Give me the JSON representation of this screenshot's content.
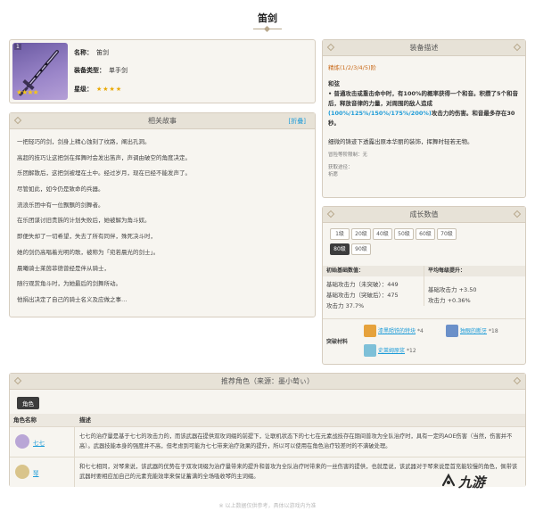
{
  "page": {
    "title": "笛剑"
  },
  "info": {
    "icon_num": "1",
    "stars_icon": "★★★★",
    "name_label": "名称：",
    "name_value": "笛剑",
    "type_label": "装备类型：",
    "type_value": "单手剑",
    "star_label": "星级：",
    "star_value": "★★★★"
  },
  "desc": {
    "title": "装备描述",
    "refine": "精炼(1/2/3/4/5)阶",
    "skill_name": "和弦",
    "skill_pre": "• 普通攻击或重击命中时，有100%的概率获得一个和音。积攒了5个和音后，释放音律的力量，对周围的敌人造成",
    "skill_hl": "(100%/125%/150%/175%/200%)",
    "skill_post": "攻击力的伤害。和音最多存在30秒。",
    "flavor": "细微的铸迹下透露出原本华丽的装饰，挥舞时轻若无物。",
    "limit": "冒险等阶限制：无",
    "source_label": "获取途径：",
    "source_value": "祈愿"
  },
  "story": {
    "title": "相关故事",
    "toggle": "[折叠]",
    "lines": [
      "一把轻巧的剑，剑身上精心蚀刻了纹路，阐出孔洞。",
      "高超的技巧让这把剑在挥舞时会发出笛声，声调由破空的角度决定。",
      "乐团解散后，这把剑被埋在土中。经过岁月，现在已经不能发声了。",
      "尽管如此，如今仍是致命的兵器。",
      "流浪乐团中有一位飘飘的剑舞者。",
      "在乐团谋讨旧贵族的计划失败后，她被解为角斗奴。",
      "即便失却了一切希望，失去了所有同伴，殊死决斗时，",
      "她的剑仍高唱着光明的歌，被称为「宛若晨光的剑士」。",
      "晨曦骑士莱茵菲德曾经是伴从骑士，",
      "随行观赏角斗时，为她最后的剑舞所动。",
      "他捐出决定了自己的骑士名义及应做之事…"
    ]
  },
  "growth": {
    "title": "成长数值",
    "levels": [
      "1级",
      "20级",
      "40级",
      "50级",
      "60级",
      "70级",
      "80级",
      "90级"
    ],
    "active_level": "80级",
    "base_head": "初始基础数值：",
    "base_lines": [
      "基础攻击力（未突破）：449",
      "基础攻击力（突破后）：475",
      "攻击力 37.7%"
    ],
    "growth_head": "平均每级提升：",
    "growth_lines": [
      "基础攻击力 +3.50",
      "攻击力 +0.36%"
    ],
    "mat_label": "突破材料",
    "materials": [
      {
        "name": "漆黑陨铁的特块",
        "count": "*4",
        "color": "#e6a23c"
      },
      {
        "name": "独眼的断牙",
        "count": "*18",
        "color": "#6b90c9"
      },
      {
        "name": "史莱姆原浆",
        "count": "*12",
        "color": "#7ec0d8"
      }
    ]
  },
  "recommend": {
    "title": "推荐角色（来源：墨小萄ぃ）",
    "tag": "角色",
    "col_name": "角色名称",
    "col_desc": "描述",
    "rows": [
      {
        "name": "七七",
        "desc": "七七的治疗量是基于七七的攻击力的，而该武器在提供双攻词缀的前提下，让联机状态下的七七在元素战技存在期间普攻为全队治疗时，具有一定的AOE伤害（当然，伤害并不高）。武器技能本身的强度并不高，但考虑到可能为七七带来治疗效果的提升，所以可以使用在角色治疗较差时的不满破处理。",
        "avatar_color": "#b9a6d6"
      },
      {
        "name": "琴",
        "desc": "和七七相同，对琴来说，该武器的优势在于双攻词缀为治疗量带来的提升和普攻为全队治疗时带来的一丝伤害的提供，也就是说，该武器对于琴来说是首充能较慢的角色，佩带该武器时要相应加自己的元素充能效率来保证蓄满的全场吸收琴的主词缀。",
        "avatar_color": "#d9c48b"
      }
    ]
  },
  "footer": {
    "text": "※ 以上数据仅供参考，具体以游戏内为准"
  },
  "watermark": {
    "text": "九游"
  },
  "colors": {
    "accent": "#1c9bd8",
    "refine": "#c96a1a",
    "star": "#f5c518"
  }
}
